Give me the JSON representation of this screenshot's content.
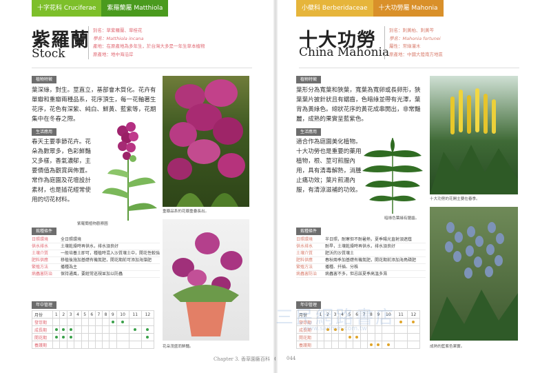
{
  "left": {
    "tabs": [
      "十字花科 Cruciferae",
      "紫羅蘭屬 Matthiola"
    ],
    "tab_colors": [
      "#7dbf2a",
      "#4a9a1e"
    ],
    "title_cn": "紫羅蘭",
    "title_en": "Stock",
    "info": [
      "別名：草紫羅蘭、草桂花",
      "學名：Matthiola incana",
      "產地：在原產地為多年生，於台灣大多是一年生草本植物",
      "原產地：地中海沿岸"
    ],
    "features_title": "植物特徵",
    "features_text": "葉深綠，對生。莖直立，基部會木質化。花卉有單瓣和重瓣兩種品系，花序頂生，每一花軸著生花序，花色有深紫、純白、鮮黃、藍紫等，花期集中在冬春之際。",
    "use_title": "生活應用",
    "use_text": "春天主要季節花卉。花朵為數眾多，色彩鮮豔又多樣，香氣濃郁，主要價值為觀賞與佈置。常作為庭園及花壇設計素材，也是插花經常使用的切花材料。",
    "caption_drawing": "紫羅蘭植物觀察圖",
    "caption_photo1": "重瓣品系的花瓣重疊長出。",
    "caption_photo2": "花朵茂盛而鮮豔。",
    "conditions_title": "栽種條件",
    "conditions": [
      {
        "k": "日照環境",
        "v": "全日照環境"
      },
      {
        "k": "供水排水",
        "v": "土壤乾燥時再供水，排水須良好"
      },
      {
        "k": "土壤介質",
        "v": "一般培養土即可，種植時混入沙質壤土中，開花性較強"
      },
      {
        "k": "肥料供應",
        "v": "移植後施加基礎有機氮肥，開花期前可添加海藻肥"
      },
      {
        "k": "繁殖方法",
        "v": "播種為主"
      },
      {
        "k": "病蟲害防治",
        "v": "保持通風，要經常巡視並加以防蟲"
      }
    ],
    "calendar_title": "年中管理",
    "calendar": {
      "header_label": "月份",
      "months": [
        "1",
        "2",
        "3",
        "4",
        "5",
        "6",
        "7",
        "8",
        "9",
        "10",
        "11",
        "12"
      ],
      "rows": [
        {
          "label": "發芽期",
          "dots": [
            0,
            0,
            0,
            0,
            0,
            0,
            0,
            0,
            1,
            1,
            0,
            0
          ]
        },
        {
          "label": "成長期",
          "dots": [
            1,
            1,
            1,
            0,
            0,
            0,
            0,
            0,
            0,
            0,
            1,
            1
          ]
        },
        {
          "label": "開花期",
          "dots": [
            1,
            1,
            1,
            0,
            0,
            0,
            0,
            0,
            0,
            0,
            0,
            1
          ]
        },
        {
          "label": "養護期",
          "dots": [
            0,
            0,
            0,
            0,
            0,
            0,
            0,
            0,
            0,
            0,
            0,
            0
          ]
        }
      ]
    },
    "page_label": "Chapter 3. 香草園藝百科",
    "page_num": "043"
  },
  "right": {
    "tabs": [
      "小蘗科 Berberidaceae",
      "十大功勞屬 Mahonia"
    ],
    "tab_colors": [
      "#e6b53b",
      "#d9902a"
    ],
    "title_cn": "十大功勞",
    "title_en": "China Mahonia",
    "info": [
      "別名：刺黃柏、刺黃芩",
      "學名：Mahonia fortunei",
      "屬性：常綠灌木",
      "原產地：中國大陸南方地區"
    ],
    "features_title": "植物特徵",
    "features_text": "葉形分為寬葉和狹葉，寬葉為寬卵或長卵形，狹葉葉片披針狀且有鋸齒，色暗綠並帶有光澤，葉背為黃綠色。總狀花序的黃花成串開出，非常豔麗，成熟的果實呈藍紫色。",
    "use_title": "生活應用",
    "use_text": "適合作為庭園美化植物。十大功勞也是重要的藥用植物，根、莖可煎服內用，具有清毒解熱，消腫止痛功效；葉片煎湯內服，有清涼滋補的功效。",
    "caption_leaf": "暗綠色葉緣有鋸齒。",
    "caption_photo1": "十大功勞的花開主要在春季。",
    "caption_photo2": "成熟的藍紫色果實。",
    "conditions_title": "栽種條件",
    "conditions": [
      {
        "k": "日照環境",
        "v": "半日照，耐寒但不耐暑熱，夏季陽光直射須遮蔭"
      },
      {
        "k": "供水排水",
        "v": "耐旱，土壤乾燥時再供水，排水須良好"
      },
      {
        "k": "土壤介質",
        "v": "肥沃的沙質壤土"
      },
      {
        "k": "肥料供應",
        "v": "春秋兩季加基礎有機氮肥，開花期前添加海鳥磷肥"
      },
      {
        "k": "繁殖方法",
        "v": "播種、扦插、分株"
      },
      {
        "k": "病蟲害防治",
        "v": "病蟲害不多，但忌該夏季高溫多濕"
      }
    ],
    "calendar_title": "年中管理",
    "calendar": {
      "header_label": "月份",
      "months": [
        "1",
        "2",
        "3",
        "4",
        "5",
        "6",
        "7",
        "8",
        "9",
        "10",
        "11",
        "12"
      ],
      "rows": [
        {
          "label": "發芽期",
          "dots": [
            0,
            0,
            0,
            0,
            0,
            0,
            0,
            0,
            0,
            0,
            1,
            1
          ]
        },
        {
          "label": "成長期",
          "dots": [
            0,
            1,
            1,
            1,
            0,
            0,
            0,
            0,
            0,
            0,
            0,
            0
          ]
        },
        {
          "label": "開花期",
          "dots": [
            0,
            0,
            0,
            0,
            1,
            1,
            0,
            0,
            0,
            0,
            0,
            0
          ]
        },
        {
          "label": "養護期",
          "dots": [
            0,
            0,
            0,
            0,
            0,
            0,
            0,
            1,
            1,
            1,
            0,
            0
          ]
        }
      ]
    },
    "page_num": "044"
  },
  "watermark": "三民網路書店",
  "watermark_url": "www.sanmin.com.tw",
  "colors": {
    "left_accent": "#e06a74",
    "right_accent": "#d87e6e",
    "dot_left": "#3aa04a",
    "dot_right": "#e0a52a",
    "section_head": "#6d6d6d"
  }
}
